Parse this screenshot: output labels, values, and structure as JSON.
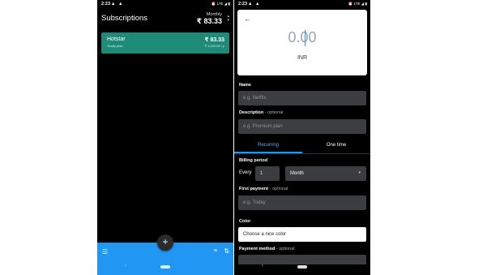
{
  "left": {
    "status": {
      "time": "2:23",
      "left_icons": "▲ ▲",
      "right_icons": "⏰ LTE ◢ ▮"
    },
    "title": "Subscriptions",
    "period": "Monthly",
    "total": "₹ 83.33",
    "sort_icon": "▴\n▾",
    "subscriptions": [
      {
        "name": "Hotstar",
        "plan": "Yearly plan",
        "price": "₹ 83.33",
        "yearly": "₹ 1,000.00 / y",
        "color": "#1e8a78"
      }
    ],
    "bottom_bar": {
      "color": "#2196f3",
      "menu_icon": "☰",
      "filter_icon": "≡",
      "sort_icon": "⇅",
      "fab_icon": "+"
    },
    "nav": {
      "back_icon": "‹"
    }
  },
  "right": {
    "status": {
      "time": "2:23",
      "left_icons": "▲ ▲",
      "right_icons": "⏰ LTE ◢ ▮"
    },
    "back_icon": "←",
    "amount": "0.00",
    "currency": "INR",
    "name": {
      "label": "Name",
      "placeholder": "e.g. Netflix"
    },
    "description": {
      "label": "Description",
      "optional": " - optional",
      "placeholder": "e.g. Premium plan"
    },
    "tabs": {
      "recurring": "Recurring",
      "one_time": "One time"
    },
    "billing": {
      "label": "Billing period",
      "every": "Every",
      "interval": "1",
      "unit": "Month",
      "caret": "▾"
    },
    "first_payment": {
      "label": "First payment",
      "optional": " - optional",
      "placeholder": "e.g. Today"
    },
    "color": {
      "label": "Color",
      "value": "Choose a nice color"
    },
    "payment_method": {
      "label": "Payment method",
      "optional": " - optional"
    },
    "nav": {
      "back_icon": "‹"
    }
  }
}
